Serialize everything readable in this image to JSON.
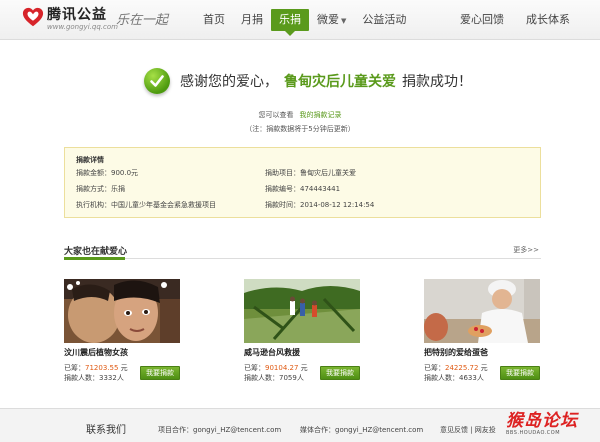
{
  "brand": {
    "name": "腾讯公益",
    "url": "www.gongyi.qq.com",
    "slogan": "乐在一起"
  },
  "nav": {
    "items": [
      {
        "label": "首页"
      },
      {
        "label": "月捐"
      },
      {
        "label": "乐捐"
      },
      {
        "label": "微爱"
      },
      {
        "label": "公益活动"
      }
    ],
    "active": "乐捐",
    "right_items": [
      {
        "label": "爱心回馈"
      },
      {
        "label": "成长体系"
      }
    ],
    "accent": "#5a9a1c"
  },
  "success": {
    "prefix": "感谢您的爱心，",
    "project": "鲁甸灾后儿童关爱",
    "suffix": "捐款成功！",
    "record_prefix": "您可以查看",
    "record_link": "我的捐款记录",
    "note": "（注：捐款数据将于5分钟后更新）"
  },
  "detail": {
    "title": "捐款详情",
    "amount": "捐款金额：900.0元",
    "project": "捐助项目：鲁甸灾后儿童关爱",
    "method": "捐款方式：乐捐",
    "number": "捐款编号：474443441",
    "org": "执行机构：中国儿童少年基金会紧急救援项目",
    "time": "捐款时间：2014-08-12 12:14:54"
  },
  "others": {
    "title": "大家也在献爱心",
    "more": "更多>>",
    "raised_label": "已筹：",
    "unit": "元",
    "donors_label": "捐款人数：",
    "button": "我要捐款",
    "cards": [
      {
        "title": "汶川震后植物女孩",
        "amount": "71203.55",
        "donors": "3332人"
      },
      {
        "title": "威马逊台风救援",
        "amount": "90104.27",
        "donors": "7059人"
      },
      {
        "title": "把特别的爱给蛋爸",
        "amount": "24225.72",
        "donors": "4633人"
      }
    ]
  },
  "footer": {
    "contact": "联系我们",
    "project_coop": "项目合作：gongyi_HZ@tencent.com",
    "media_coop": "媒体合作：gongyi_HZ@tencent.com",
    "feedback": "意见反馈 | 网友投",
    "watermark_main": "猴岛论坛",
    "watermark_sub": "BBS.HOUDAO.COM"
  },
  "icons": [
    "heart-logo-icon",
    "check-circle-icon",
    "chevron-down-icon"
  ]
}
